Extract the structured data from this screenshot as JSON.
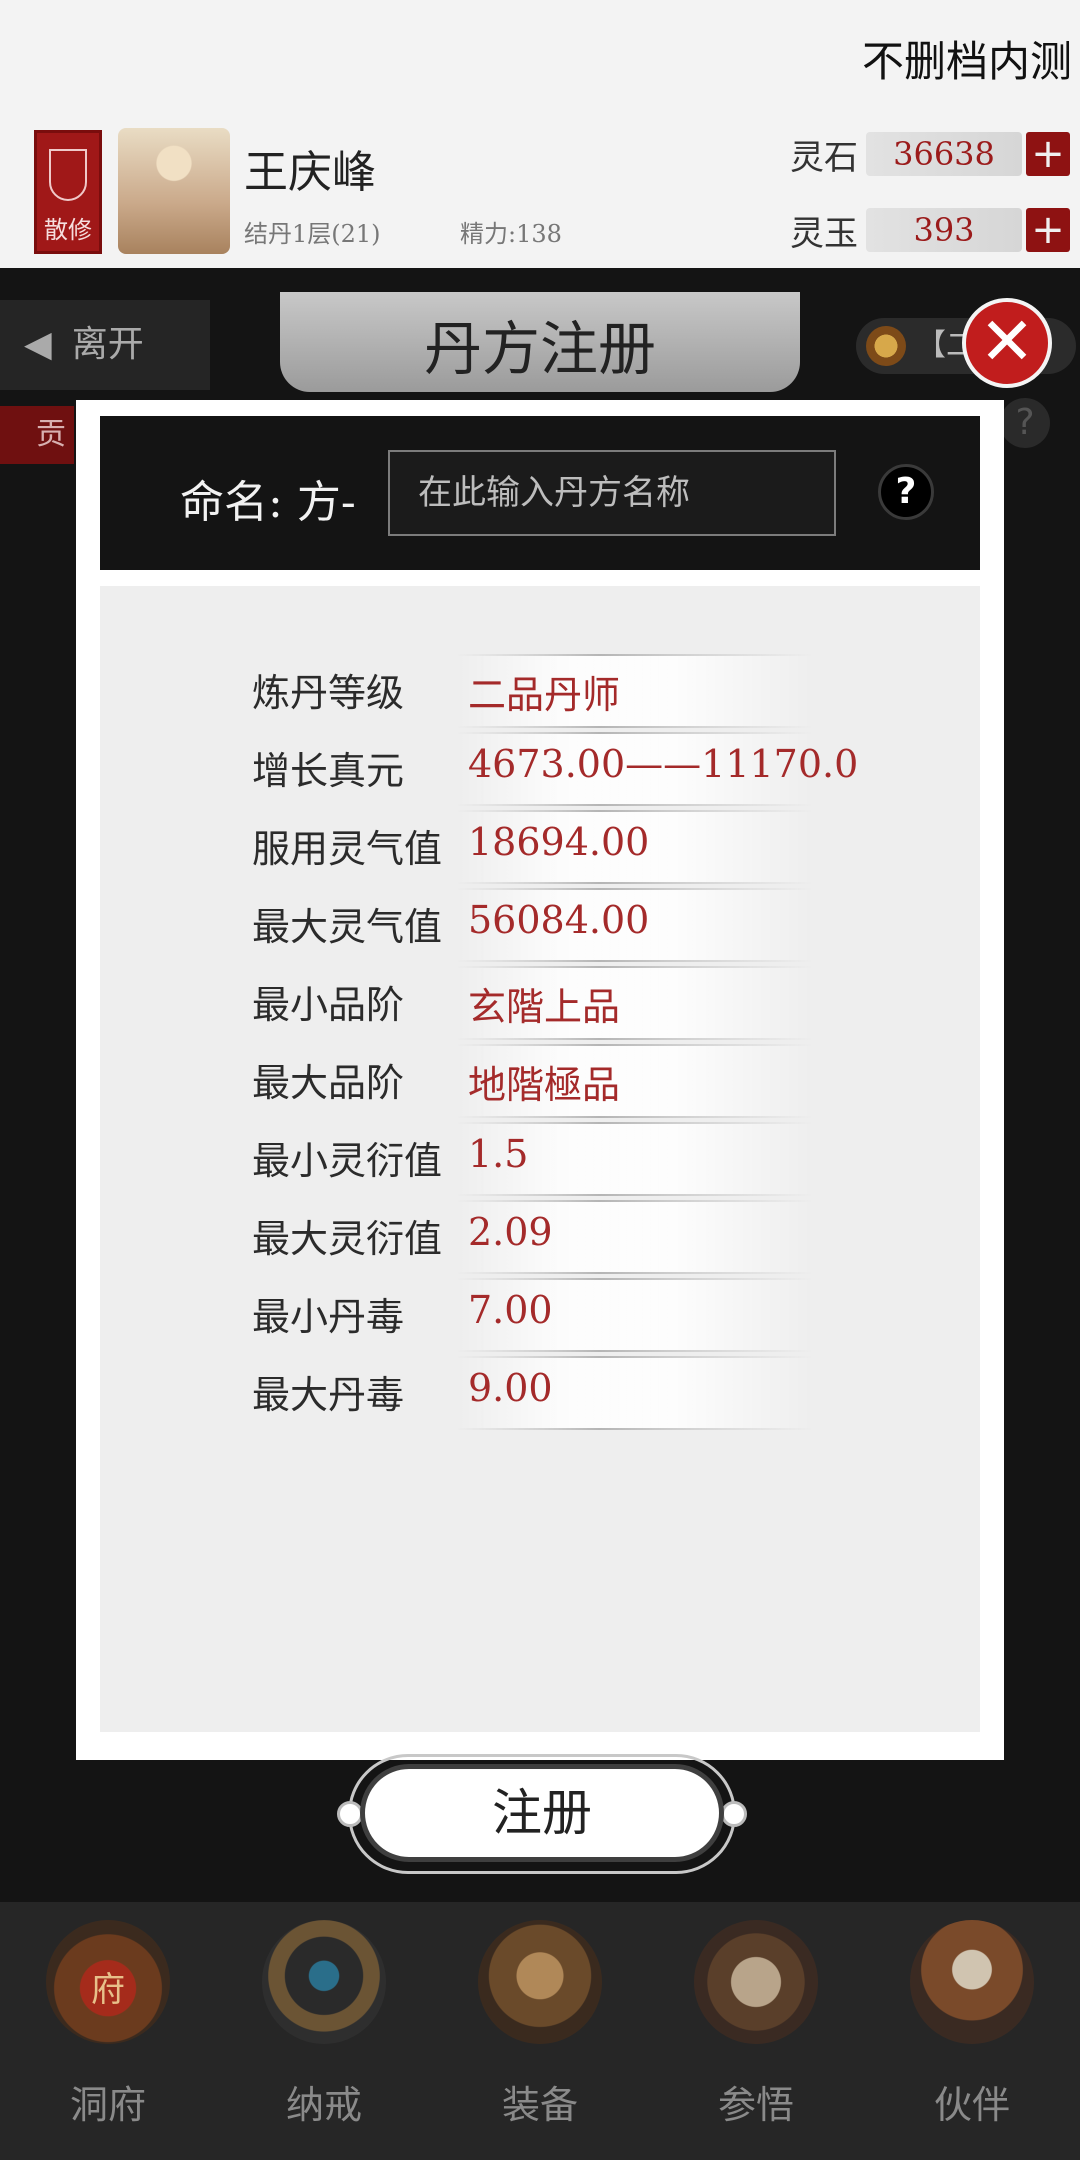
{
  "header": {
    "caption": "不删档内测",
    "sect_badge": "散修",
    "player_name": "王庆峰",
    "realm": "结丹1层(21)",
    "energy": "精力:138",
    "currencies": [
      {
        "label": "灵石",
        "value": "36638"
      },
      {
        "label": "灵玉",
        "value": "393"
      }
    ],
    "plus_symbol": "+"
  },
  "page": {
    "title": "丹方注册",
    "leave_label": "离开",
    "rank_label": "【二",
    "left_tab": "贡",
    "help_symbol": "?"
  },
  "modal": {
    "name_label": "命名:",
    "name_prefix": "方-",
    "name_placeholder": "在此输入丹方名称",
    "help_symbol": "?",
    "close_symbol": "✕",
    "stats": [
      {
        "label": "炼丹等级",
        "value": "二品丹师"
      },
      {
        "label": "增长真元",
        "value": "4673.00——11170.0"
      },
      {
        "label": "服用灵气值",
        "value": "18694.00"
      },
      {
        "label": "最大灵气值",
        "value": "56084.00"
      },
      {
        "label": "最小品阶",
        "value": "玄階上品"
      },
      {
        "label": "最大品阶",
        "value": "地階極品"
      },
      {
        "label": "最小灵衍值",
        "value": "1.5"
      },
      {
        "label": "最大灵衍值",
        "value": "2.09"
      },
      {
        "label": "最小丹毒",
        "value": "7.00"
      },
      {
        "label": "最大丹毒",
        "value": "9.00"
      }
    ],
    "register_label": "注册"
  },
  "bottom_nav": [
    {
      "label": "洞府",
      "icon": "cave-mansion-icon",
      "badge": "府"
    },
    {
      "label": "纳戒",
      "icon": "ring-icon"
    },
    {
      "label": "装备",
      "icon": "armor-icon"
    },
    {
      "label": "参悟",
      "icon": "scroll-icon"
    },
    {
      "label": "伙伴",
      "icon": "partner-icon"
    }
  ],
  "colors": {
    "accent_red": "#a42a2a",
    "close_red": "#c11d1d",
    "overlay": "#141414"
  }
}
